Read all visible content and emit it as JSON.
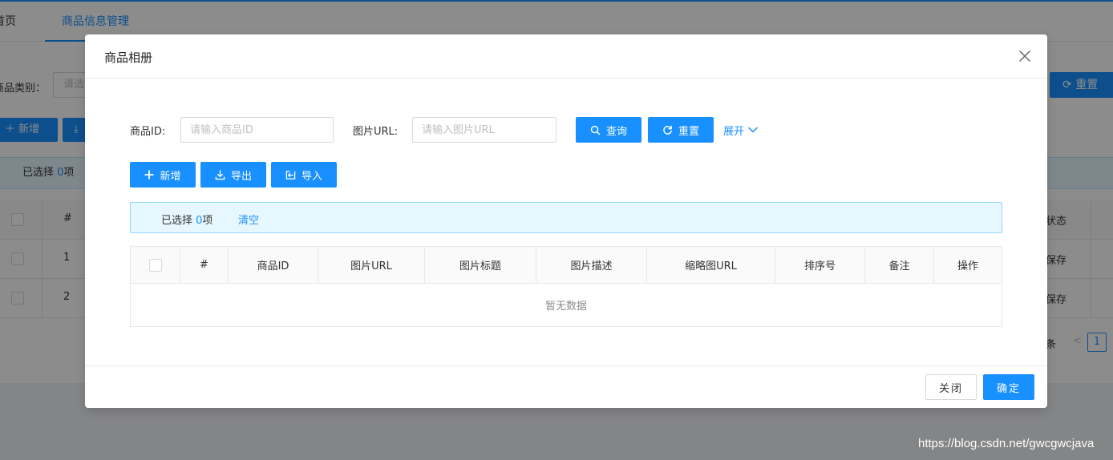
{
  "background": {
    "tabs": [
      {
        "label": "首页"
      },
      {
        "label": "商品信息管理"
      }
    ],
    "search": {
      "label": "商品类别：",
      "placeholder": "请选"
    },
    "reset_label": "重置",
    "add_label": "新增",
    "selected": {
      "prefix": "已选择 ",
      "count": "0",
      "suffix": "项"
    },
    "table": {
      "header_index": "#",
      "header_status": "状态",
      "rows": [
        {
          "index": "1",
          "status": "保存"
        },
        {
          "index": "2",
          "status": "保存"
        }
      ]
    },
    "pager": {
      "total_suffix": "条",
      "prev": "<",
      "current": "1"
    }
  },
  "modal": {
    "title": "商品相册",
    "query": {
      "product_id_label": "商品ID:",
      "product_id_placeholder": "请输入商品ID",
      "image_url_label": "图片URL:",
      "image_url_placeholder": "请输入图片URL",
      "search_label": "查询",
      "reset_label": "重置",
      "expand_label": "展开"
    },
    "toolbar": {
      "add_label": "新增",
      "export_label": "导出",
      "import_label": "导入"
    },
    "alert": {
      "prefix": "已选择 ",
      "count": "0",
      "suffix": "项",
      "clear_label": "清空"
    },
    "table": {
      "columns": [
        "#",
        "商品ID",
        "图片URL",
        "图片标题",
        "图片描述",
        "缩略图URL",
        "排序号",
        "备注",
        "操作"
      ],
      "empty_text": "暂无数据"
    },
    "footer": {
      "close_label": "关闭",
      "ok_label": "确定"
    }
  },
  "watermark": "https://blog.csdn.net/gwcgwcjava",
  "colors": {
    "primary": "#1890ff",
    "mask": "rgba(0,0,0,0.45)",
    "alert_bg": "#e6f7ff"
  },
  "icons": [
    "close-icon",
    "search-icon",
    "reload-icon",
    "chevron-down-icon",
    "plus-icon",
    "download-icon",
    "import-icon"
  ]
}
